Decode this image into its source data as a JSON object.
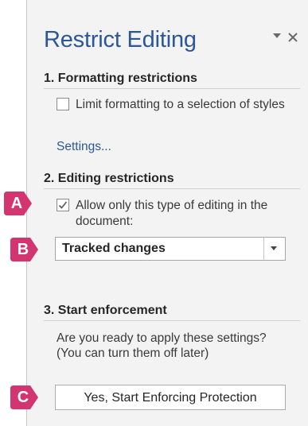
{
  "pane": {
    "title": "Restrict Editing",
    "pin_icon": "triangle-down-icon",
    "close_icon": "close-icon"
  },
  "formatting": {
    "heading": "1. Formatting restrictions",
    "checkbox_label": "Limit formatting to a selection of styles",
    "checked": false,
    "settings_link": "Settings..."
  },
  "editing": {
    "heading": "2. Editing restrictions",
    "checkbox_label": "Allow only this type of editing in the document:",
    "checked": true,
    "dropdown_value": "Tracked changes"
  },
  "enforcement": {
    "heading": "3. Start enforcement",
    "description": "Are you ready to apply these settings? (You can turn them off later)",
    "button_label": "Yes, Start Enforcing Protection"
  },
  "callouts": [
    "A",
    "B",
    "C"
  ],
  "colors": {
    "accent": "#2b579a",
    "callout": "#d2356f",
    "pane_background": "#f3f3f3"
  }
}
